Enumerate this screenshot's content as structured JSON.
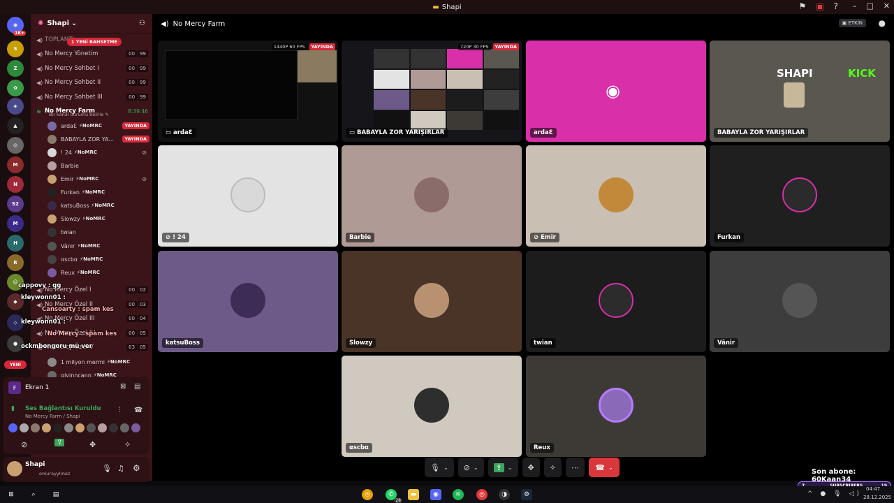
{
  "window": {
    "title": "Shapi"
  },
  "server": {
    "name": "Shapi",
    "mention_badge": "1 YENİ BAHSETME",
    "rail_top_badge": "1K+",
    "new_badge": "YENİ"
  },
  "channels_top": [
    {
      "name": "TOPLANTI",
      "c1": "",
      "c2": ""
    },
    {
      "name": "No Mercy Yönetim",
      "c1": "00",
      "c2": "99"
    },
    {
      "name": "No Mercy Sohbet I",
      "c1": "00",
      "c2": "99"
    },
    {
      "name": "No Mercy Sohbet II",
      "c1": "00",
      "c2": "99"
    },
    {
      "name": "No Mercy Sohbet III",
      "c1": "00",
      "c2": "99"
    }
  ],
  "active_channel": {
    "name": "No Mercy Farm",
    "timer": "8:39:46",
    "status_hint": "Bir kanal durumu belirle"
  },
  "members": [
    {
      "name": "ardaƐ",
      "tag": "⚡NoMRC",
      "live": "YAYINDA",
      "color": "#7a6aa8"
    },
    {
      "name": "BABAYLA ZOR YA...",
      "tag": "",
      "live": "YAYINDA",
      "color": "#8a7a6a"
    },
    {
      "name": "! 24",
      "tag": "⚡NoMRC",
      "live": "",
      "color": "#d8d8d8"
    },
    {
      "name": "Barbie",
      "tag": "",
      "live": "",
      "color": "#b89ea0"
    },
    {
      "name": "Emir",
      "tag": "⚡NoMRC",
      "live": "",
      "color": "#c9a070"
    },
    {
      "name": "Furkan",
      "tag": "⚡NoMRC",
      "live": "",
      "color": "#222"
    },
    {
      "name": "katsuBoss",
      "tag": "⚡NoMRC",
      "live": "",
      "color": "#3a2a4a"
    },
    {
      "name": "Slowzy",
      "tag": "⚡NoMRC",
      "live": "",
      "color": "#c9a070"
    },
    {
      "name": "twian",
      "tag": "",
      "live": "",
      "color": "#333"
    },
    {
      "name": "Vânir",
      "tag": "⚡NoMRC",
      "live": "",
      "color": "#555"
    },
    {
      "name": "αscbα",
      "tag": "⚡NoMRC",
      "live": "",
      "color": "#444"
    },
    {
      "name": "Reux",
      "tag": "⚡NoMRC",
      "live": "",
      "color": "#7a5aa0"
    }
  ],
  "channels_bottom": [
    {
      "name": "No Mercy Özel I",
      "c1": "00",
      "c2": "02"
    },
    {
      "name": "No Mercy Özel II",
      "c1": "00",
      "c2": "03"
    },
    {
      "name": "No Mercy Özel III",
      "c1": "00",
      "c2": "04"
    },
    {
      "name": "No Mercy Özel IV",
      "c1": "00",
      "c2": "05"
    },
    {
      "name": "No Mercy Özel V",
      "c1": "03",
      "c2": "05"
    }
  ],
  "extra_members": [
    {
      "name": "1 milyon mermi",
      "tag": "⚡NoMRC"
    },
    {
      "name": "givinncann",
      "tag": "⚡NoMRC"
    }
  ],
  "chat_overlay": [
    {
      "text": "cappovy : gg"
    },
    {
      "text": "kleywonn01 :"
    },
    {
      "text": "Cansoarty : spam kes"
    },
    {
      "text": "kleywonn01 :"
    },
    {
      "text": "No Mercy : spam kes"
    },
    {
      "text": "ockmbongoru mu ver"
    }
  ],
  "voice_panel": {
    "screen_label": "Ekran 1",
    "status": "Ses Bağlantısı Kuruldu",
    "location": "No Mercy Farm / Shapi"
  },
  "user": {
    "name": "Shapi",
    "handle": "omurayylmaz"
  },
  "main": {
    "channel": "No Mercy Farm",
    "activity_label": "ETKİN"
  },
  "tiles": [
    {
      "label": "ardaƐ",
      "bg": "#1a1a1a",
      "kind": "stream",
      "quality": "1440P 60 FPS",
      "live": "YAYINDA"
    },
    {
      "label": "BABAYLA ZOR YARIŞIRLAR",
      "bg": "#15151a",
      "kind": "stream",
      "quality": "720P 30 FPS",
      "live": "YAYINDA"
    },
    {
      "label": "ardaƐ",
      "bg": "#d92fa8",
      "kind": "discord"
    },
    {
      "label": "BABAYLA ZOR YARIŞIRLAR",
      "bg": "#5a5750",
      "kind": "kick",
      "brand1": "SHAPI",
      "brand2": "KICK"
    },
    {
      "label": "! 24",
      "bg": "#e3e3e3",
      "kind": "avatar",
      "av": "#d9d9d9",
      "muted": true
    },
    {
      "label": "Barbie",
      "bg": "#b09a96",
      "kind": "avatar",
      "av": "#8a6d6a"
    },
    {
      "label": "Emir",
      "bg": "#c9bfb2",
      "kind": "avatar",
      "av": "#c2893a",
      "muted": true
    },
    {
      "label": "Furkan",
      "bg": "#1f1f1f",
      "kind": "avatar",
      "av": "#2b2b2b"
    },
    {
      "label": "katsuBoss",
      "bg": "#6d5a88",
      "kind": "avatar",
      "av": "#3d2d56"
    },
    {
      "label": "Slowzy",
      "bg": "#4a3428",
      "kind": "avatar",
      "av": "#b89270"
    },
    {
      "label": "twian",
      "bg": "#1c1c1c",
      "kind": "avatar",
      "av": "#2c2c2c"
    },
    {
      "label": "Vânir",
      "bg": "#3d3d3d",
      "kind": "avatar",
      "av": "#555"
    },
    {
      "label": "αscbα",
      "bg": "#cfc9c0",
      "kind": "avatar",
      "av": "#2e2e2e"
    },
    {
      "label": "Reux",
      "bg": "#3d3a36",
      "kind": "avatar",
      "av": "#8a6ab8"
    }
  ],
  "overlay": {
    "last_sub": "Son abone: 60Kaan34",
    "subs_badge": "SUBSCRIBERS",
    "subs_count": "7",
    "subs_goal": "19"
  },
  "taskbar": {
    "clock": "04:47",
    "date": "28.12.2025",
    "whatsapp_badge": "28"
  }
}
